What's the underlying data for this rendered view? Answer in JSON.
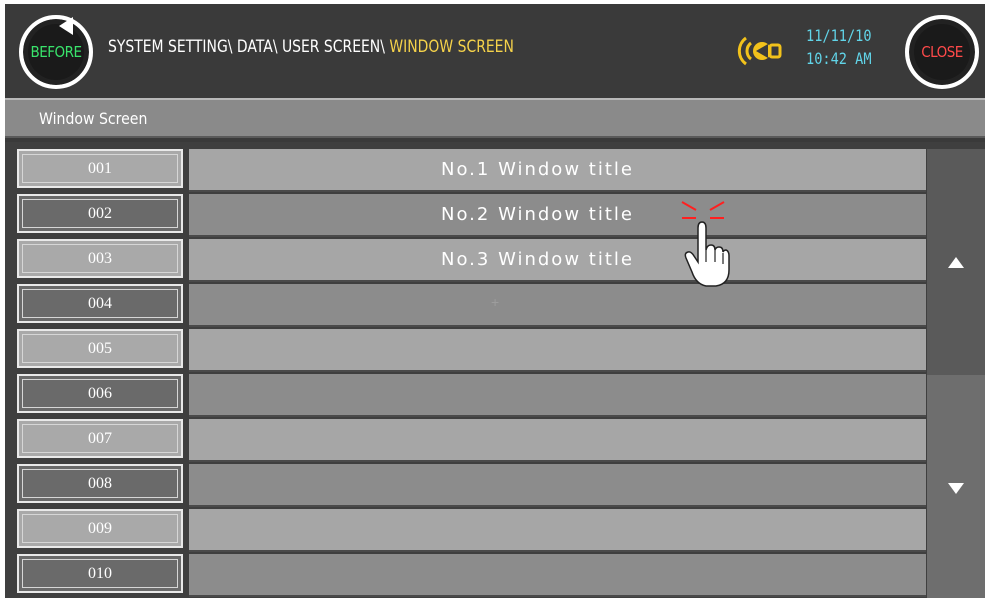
{
  "header": {
    "before_label": "BEFORE",
    "close_label": "CLOSE",
    "path_prefix": "SYSTEM SETTING\\ DATA\\ USER SCREEN\\ ",
    "path_current": "WINDOW SCREEN",
    "date": "11/11/10",
    "time": "10:42 AM",
    "status_icon": "ringing-bell-icon"
  },
  "title_bar": {
    "label": "Window Screen"
  },
  "rows": [
    {
      "number": "001",
      "title": "No.1 Window title"
    },
    {
      "number": "002",
      "title": "No.2 Window title"
    },
    {
      "number": "003",
      "title": "No.3 Window title"
    },
    {
      "number": "004",
      "title": ""
    },
    {
      "number": "005",
      "title": ""
    },
    {
      "number": "006",
      "title": ""
    },
    {
      "number": "007",
      "title": ""
    },
    {
      "number": "008",
      "title": ""
    },
    {
      "number": "009",
      "title": ""
    },
    {
      "number": "010",
      "title": ""
    }
  ],
  "scrollbar": {
    "up_icon": "triangle-up-icon",
    "down_icon": "triangle-down-icon"
  },
  "colors": {
    "before_text": "#39e36b",
    "close_text": "#ff4a4a",
    "path_current": "#f5d24a",
    "datetime": "#61d4e8",
    "bell_icon": "#f2c21b",
    "tap_indicator": "#ff2020"
  }
}
